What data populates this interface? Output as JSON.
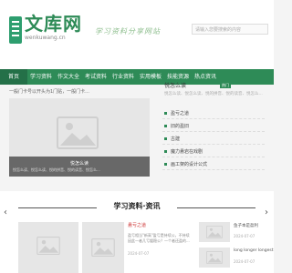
{
  "header": {
    "logo_title": "文库网",
    "logo_sub": "wenkuwang.cn",
    "slogan": "学习资料分享网站",
    "search_placeholder": "请输入您要搜索的内容"
  },
  "nav": [
    "首页",
    "学习资料",
    "作文大全",
    "考试资料",
    "行业资料",
    "实用模板",
    "技能资源",
    "热点资讯"
  ],
  "breadcrumb": "一般门卡号以开头为1门贴，一般门卡...",
  "feature": {
    "caption_title": "悦怎么读",
    "caption_desc": "悦怎么读、悦怎么读、悦的拼音、悦的读音、悦怎么...",
    "side_title": "悦怎么读",
    "tag": "热门",
    "side_desc": "悦怎么读、悦怎么读、悦的拼音、悦的读音、悦怎么...",
    "list": [
      "盈亏之道",
      "旧的盈旧",
      "古建",
      "魔力悬岩在戏剧",
      "画工架的设计公式"
    ]
  },
  "section": {
    "title": "学习资料·资讯",
    "mid_title": "悬亏之道",
    "mid_desc": "盈亏相当\"新高\"盈亏是持续公，不持续因此一者几亏缓稳公？一个者还盈的...",
    "mid_date": "2024-07-07",
    "right": [
      {
        "title": "鱼子本是盈利",
        "date": "2024-07-07"
      },
      {
        "title": "long longer longest",
        "date": "2024-07-07"
      }
    ]
  },
  "colors": {
    "brand": "#2e8b57"
  }
}
